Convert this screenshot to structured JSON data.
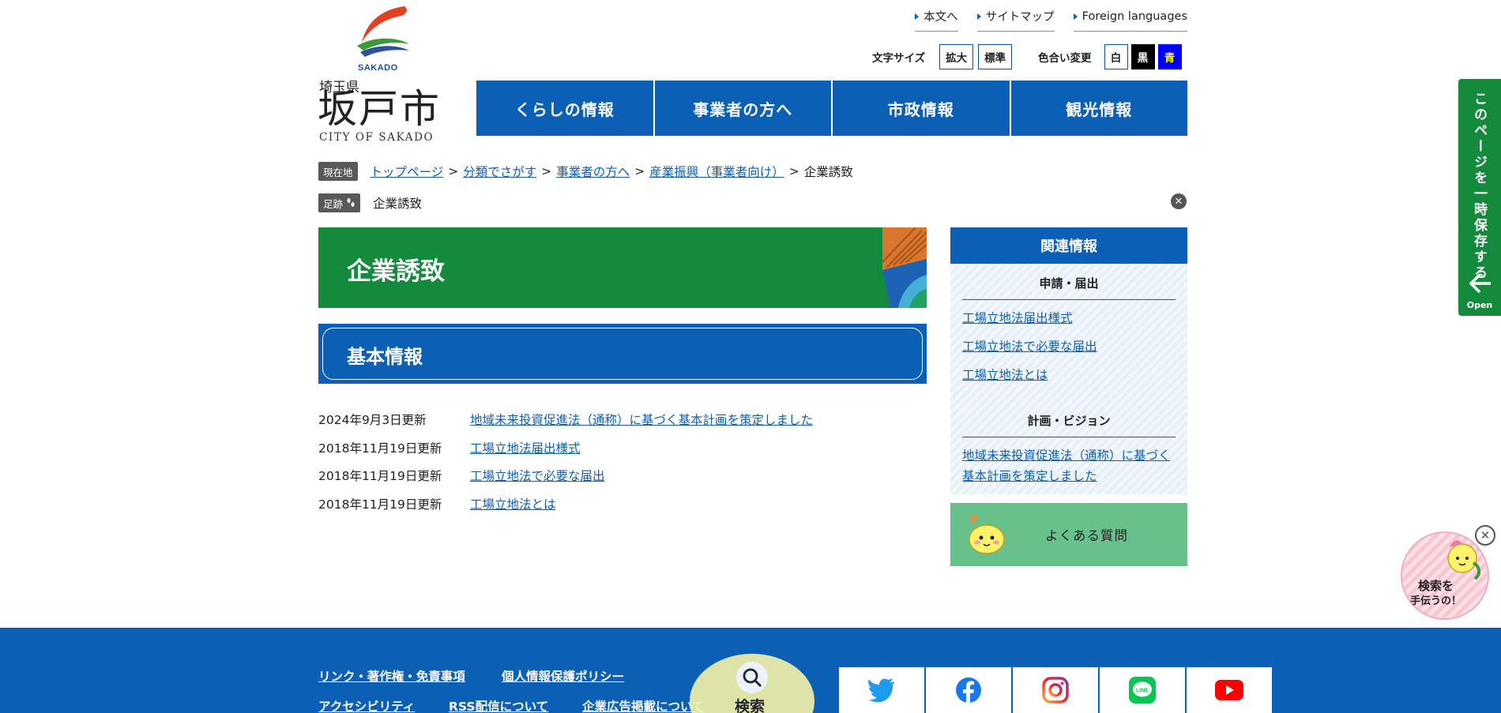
{
  "header": {
    "logo": {
      "en_small": "SAKADO",
      "prefecture": "埼玉県",
      "city": "坂戸市",
      "city_en": "CITY OF SAKADO",
      "colors": {
        "red": "#e2401f",
        "green": "#3c9a3a",
        "blue": "#2c4f9e"
      }
    },
    "util_links": [
      "本文へ",
      "サイトマップ",
      "Foreign languages"
    ],
    "text_size": {
      "label": "文字サイズ",
      "larger": "拡大",
      "standard": "標準"
    },
    "color_change": {
      "label": "色合い変更",
      "options": [
        {
          "label": "白",
          "bg": "#ffffff",
          "fg": "#222222"
        },
        {
          "label": "黒",
          "bg": "#000000",
          "fg": "#ffffff"
        },
        {
          "label": "青",
          "bg": "#0000ff",
          "fg": "#ffff00"
        }
      ]
    },
    "global_nav": [
      "くらしの情報",
      "事業者の方へ",
      "市政情報",
      "観光情報"
    ]
  },
  "breadcrumb": {
    "tag": "現在地",
    "items": [
      "トップページ",
      "分類でさがす",
      "事業者の方へ",
      "産業振興（事業者向け）"
    ],
    "current": "企業誘致",
    "separator": ">"
  },
  "footprint": {
    "tag": "足跡",
    "items": [
      "企業誘致"
    ]
  },
  "main": {
    "title": "企業誘致",
    "section_title": "基本情報",
    "updates": [
      {
        "date": "2024年9月3日更新",
        "title": "地域未来投資促進法（通称）に基づく基本計画を策定しました"
      },
      {
        "date": "2018年11月19日更新",
        "title": "工場立地法届出様式"
      },
      {
        "date": "2018年11月19日更新",
        "title": "工場立地法で必要な届出"
      },
      {
        "date": "2018年11月19日更新",
        "title": "工場立地法とは"
      }
    ]
  },
  "sidebar": {
    "title": "関連情報",
    "groups": [
      {
        "category": "申請・届出",
        "links": [
          "工場立地法届出様式",
          "工場立地法で必要な届出",
          "工場立地法とは"
        ]
      },
      {
        "category": "計画・ビジョン",
        "links": [
          "地域未来投資促進法（通称）に基づく基本計画を策定しました"
        ]
      }
    ],
    "faq": "よくある質問"
  },
  "save_tab": {
    "label": "このページを一時保存する",
    "open": "Open"
  },
  "helper": {
    "line1": "検索を",
    "line2": "手伝うの！"
  },
  "footer": {
    "links_row1": [
      "リンク・著作権・免責事項",
      "個人情報保護ポリシー"
    ],
    "links_row2": [
      "アクセシビリティ",
      "RSS配信について",
      "企業広告掲載について"
    ],
    "search_label": "検索",
    "social": [
      "twitter-icon",
      "facebook-icon",
      "instagram-icon",
      "line-icon",
      "youtube-icon"
    ]
  },
  "colors": {
    "primary_blue": "#0b5fb4",
    "green": "#138a3c",
    "faq_green": "#67c18a"
  }
}
